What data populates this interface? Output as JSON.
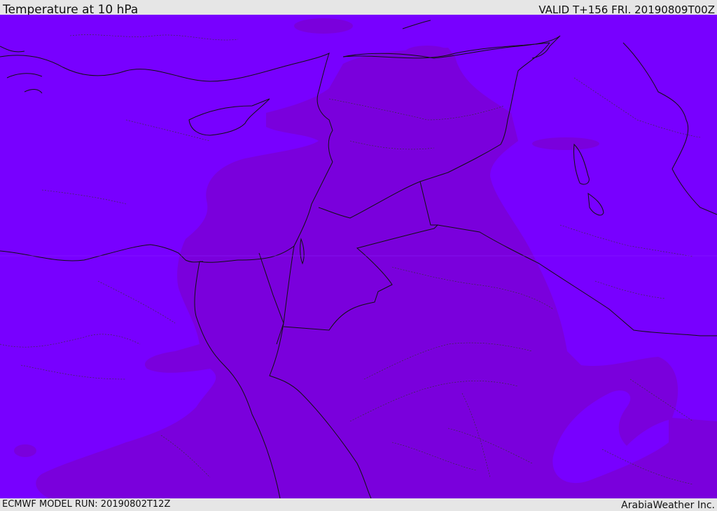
{
  "header": {
    "title": "Temperature at 10 hPa",
    "valid_time": "VALID T+156 FRI. 20190809T00Z"
  },
  "footer": {
    "model_run": "ECMWF MODEL RUN: 20190802T12Z",
    "credit": "ArabiaWeather Inc."
  },
  "colors": {
    "background_field": "#7800ff",
    "warmer_field": "#7a00dc",
    "land_border": "#111111",
    "province_border": "#333333",
    "bar_background": "#e6e6e6"
  }
}
